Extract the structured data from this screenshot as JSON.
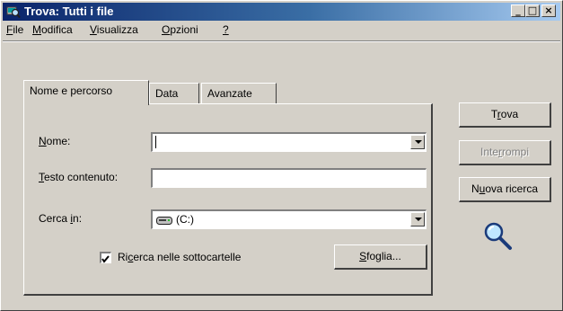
{
  "window": {
    "title": "Trova: Tutti i file",
    "controls": {
      "minimize": "_",
      "maximize": "□",
      "close": "×"
    }
  },
  "menu": [
    {
      "pre": "",
      "key": "F",
      "post": "ile"
    },
    {
      "pre": "",
      "key": "M",
      "post": "odifica"
    },
    {
      "pre": "",
      "key": "V",
      "post": "isualizza"
    },
    {
      "pre": "",
      "key": "O",
      "post": "pzioni"
    },
    {
      "pre": "",
      "key": "?",
      "post": ""
    }
  ],
  "tabs": [
    {
      "label": "Nome e percorso",
      "active": true
    },
    {
      "label": "Data",
      "active": false
    },
    {
      "label": "Avanzate",
      "active": false
    }
  ],
  "form": {
    "nome": {
      "pre": "",
      "key": "N",
      "post": "ome:",
      "value": ""
    },
    "testo": {
      "pre": "",
      "key": "T",
      "post": "esto contenuto:",
      "value": ""
    },
    "cerca": {
      "pre": "Cerca ",
      "key": "i",
      "post": "n:",
      "value": "(C:)"
    },
    "sottocartelle": {
      "pre": "Ri",
      "key": "c",
      "post": "erca nelle sottocartelle",
      "checked": true
    },
    "sfoglia": {
      "pre": "",
      "key": "S",
      "post": "foglia..."
    }
  },
  "buttons": {
    "trova": {
      "pre": "T",
      "key": "r",
      "post": "ova"
    },
    "interrompi": {
      "pre": "Inte",
      "key": "r",
      "post": "rompi"
    },
    "nuova": {
      "pre": "N",
      "key": "u",
      "post": "ova ricerca"
    }
  },
  "icons": {
    "title": "find-files-icon",
    "drive": "hard-drive-icon",
    "search": "magnifier-icon",
    "dropdown": "chevron-down-icon",
    "check": "checkmark-icon"
  },
  "colors": {
    "face": "#d4d0c8",
    "titlebar_start": "#0a246a",
    "titlebar_end": "#a6caf0",
    "disabled_text": "#808080"
  }
}
